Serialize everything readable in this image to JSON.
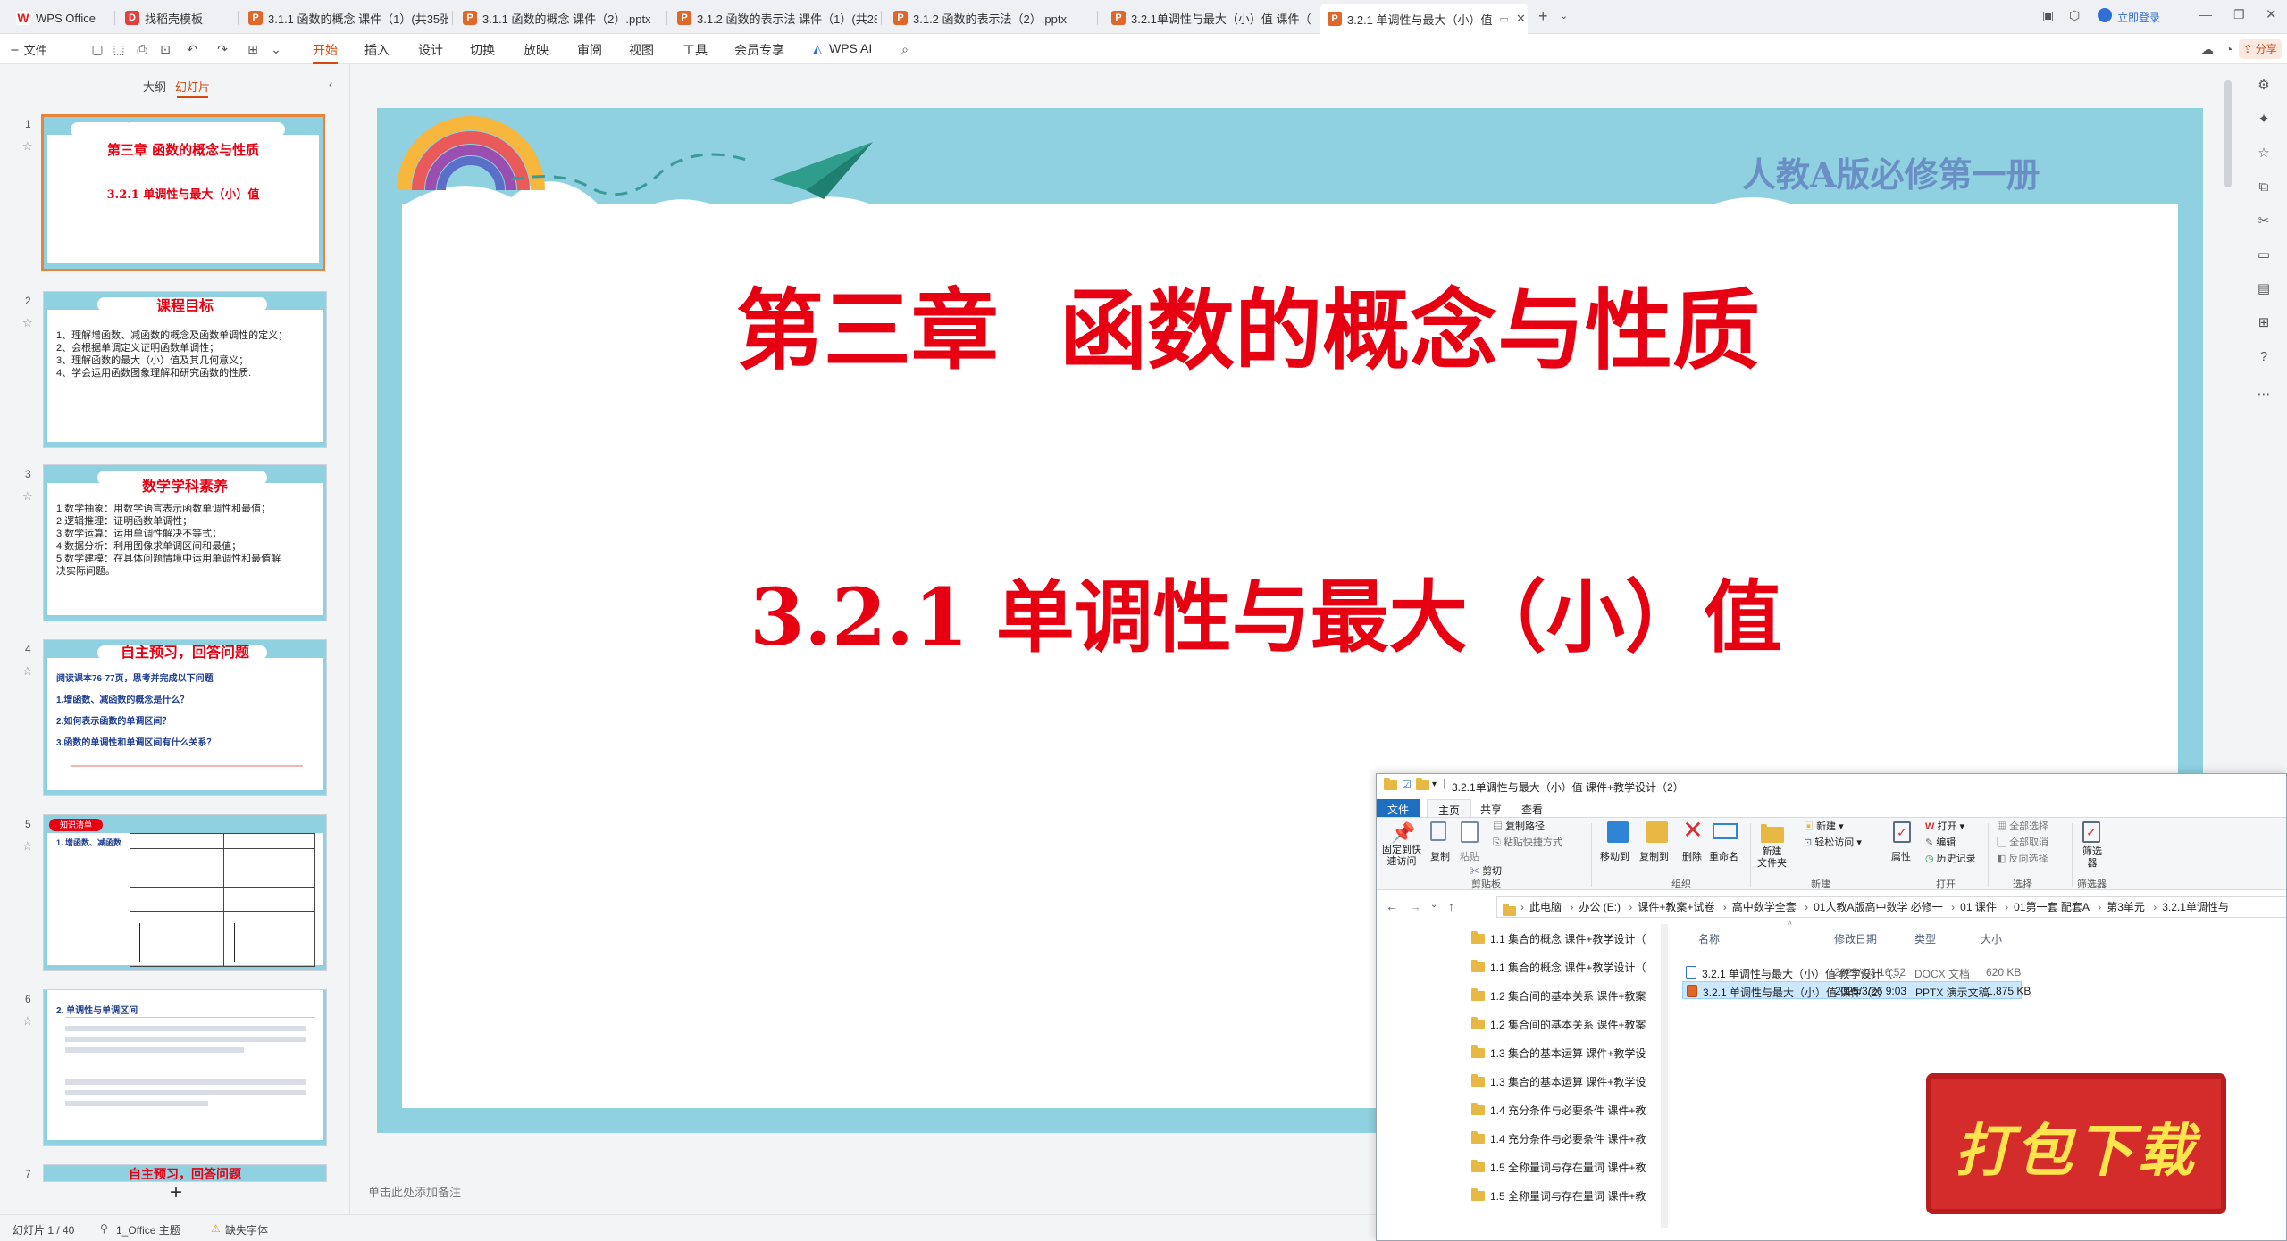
{
  "tabs": [
    {
      "label": "WPS Office",
      "icon": "wps-logo-icon"
    },
    {
      "label": "找稻壳模板",
      "icon": "template-icon"
    },
    {
      "label": "3.1.1 函数的概念 课件（1）(共35张",
      "icon": "pptx-file-icon"
    },
    {
      "label": "3.1.1 函数的概念 课件（2）.pptx",
      "icon": "pptx-file-icon"
    },
    {
      "label": "3.1.2 函数的表示法 课件（1）(共28",
      "icon": "pptx-file-icon"
    },
    {
      "label": "3.1.2 函数的表示法（2）.pptx",
      "icon": "pptx-file-icon"
    },
    {
      "label": "3.2.1单调性与最大（小）值 课件（1",
      "icon": "pptx-file-icon"
    },
    {
      "label": "3.2.1 单调性与最大（小）值",
      "icon": "pptx-file-icon"
    }
  ],
  "top_right": {
    "login": "立即登录"
  },
  "menubar": {
    "file": "三 文件",
    "items": [
      "开始",
      "插入",
      "设计",
      "切换",
      "放映",
      "审阅",
      "视图",
      "工具",
      "会员专享"
    ],
    "wps_ai": "WPS AI",
    "share": "分享"
  },
  "panel": {
    "outline": "大纲",
    "slides": "幻灯片"
  },
  "thumbs": [
    {
      "num": "1",
      "title": "第三章 函数的概念与性质",
      "subtitle": "3.2.1 单调性与最大（小）值"
    },
    {
      "num": "2",
      "title": "课程目标",
      "lines": [
        "1、理解增函数、减函数的概念及函数单调性的定义；",
        "2、会根据单调定义证明函数单调性；",
        "3、理解函数的最大（小）值及其几何意义；",
        "4、学会运用函数图象理解和研究函数的性质."
      ]
    },
    {
      "num": "3",
      "title": "数学学科素养",
      "lines": [
        "1.数学抽象：用数学语言表示函数单调性和最值；",
        "2.逻辑推理：证明函数单调性；",
        "3.数学运算：运用单调性解决不等式；",
        "4.数据分析：利用图像求单调区间和最值；",
        "5.数学建模：在具体问题情境中运用单调性和最值解",
        "决实际问题。"
      ]
    },
    {
      "num": "4",
      "title": "自主预习，回答问题",
      "lines": [
        "阅读课本76-77页，思考并完成以下问题",
        "1.增函数、减函数的概念是什么？",
        "2.如何表示函数的单调区间？",
        "3.函数的单调性和单调区间有什么关系？"
      ]
    },
    {
      "num": "5",
      "title": "知识清单",
      "lines": [
        "1. 增函数、减函数"
      ]
    },
    {
      "num": "6",
      "title": "",
      "lines": [
        "2. 单调性与单调区间"
      ]
    },
    {
      "num": "7",
      "title": "自主预习，回答问题"
    }
  ],
  "slide": {
    "edition": "人教A版必修第一册",
    "chapter": "第三章  函数的概念与性质",
    "section": "3.2.1 单调性与最大（小）值"
  },
  "notes_placeholder": "单击此处添加备注",
  "status": {
    "slide_count": "幻灯片 1 / 40",
    "theme": "1_Office 主题",
    "missing_font": "缺失字体"
  },
  "explorer": {
    "title": "3.2.1单调性与最大（小）值 课件+教学设计（2）",
    "tabs": [
      "文件",
      "主页",
      "共享",
      "查看"
    ],
    "ribbon": {
      "pin": "固定到快\n速访问",
      "copy": "复制",
      "paste": "粘贴",
      "copy_path": "复制路径",
      "paste_shortcut": "粘贴快捷方式",
      "cut": "剪切",
      "clipboard_group": "剪贴板",
      "move_to": "移动到",
      "copy_to": "复制到",
      "delete": "删除",
      "rename": "重命名",
      "organize_group": "组织",
      "new_folder": "新建\n文件夹",
      "new_item": "新建",
      "easy_access": "轻松访问",
      "new_group": "新建",
      "properties": "属性",
      "open": "打开",
      "edit": "编辑",
      "history": "历史记录",
      "open_group": "打开",
      "select_all": "全部选择",
      "select_none": "全部取消",
      "invert": "反向选择",
      "select_group": "选择",
      "filter": "筛选\n器",
      "filter_group": "筛选器"
    },
    "breadcrumbs": [
      "此电脑",
      "办公 (E:)",
      "课件+教案+试卷",
      "高中数学全套",
      "01人教A版高中数学 必修一",
      "01 课件",
      "01第一套 配套A",
      "第3单元",
      "3.2.1单调性与"
    ],
    "nav_items": [
      "1.1 集合的概念 课件+教学设计（",
      "1.1 集合的概念 课件+教学设计（",
      "1.2 集合间的基本关系 课件+教案",
      "1.2 集合间的基本关系 课件+教案",
      "1.3 集合的基本运算 课件+教学设",
      "1.3 集合的基本运算 课件+教学设",
      "1.4 充分条件与必要条件 课件+教",
      "1.4 充分条件与必要条件 课件+教",
      "1.5 全称量词与存在量词 课件+教",
      "1.5 全称量词与存在量词 课件+教"
    ],
    "columns": {
      "name": "名称",
      "date": "修改日期",
      "type": "类型",
      "size": "大小"
    },
    "files": [
      {
        "name": "3.2.1 单调性与最大（小）值 教学设计（...",
        "date": "2025/4/3 16:52",
        "type": "DOCX 文档",
        "size": "620 KB",
        "icon": "docx-file-icon",
        "selected": false
      },
      {
        "name": "3.2.1 单调性与最大（小）值 课件（2）",
        "date": "2025/3/26 9:03",
        "type": "PPTX 演示文稿",
        "size": "1,875 KB",
        "icon": "pptx-file-icon",
        "selected": true
      }
    ]
  },
  "download_badge": "打包下载",
  "colors": {
    "accent": "#d9480f",
    "slide_band": "#8fd1e0",
    "title_red": "#e60012",
    "edition_blue": "#6a8fc4"
  }
}
